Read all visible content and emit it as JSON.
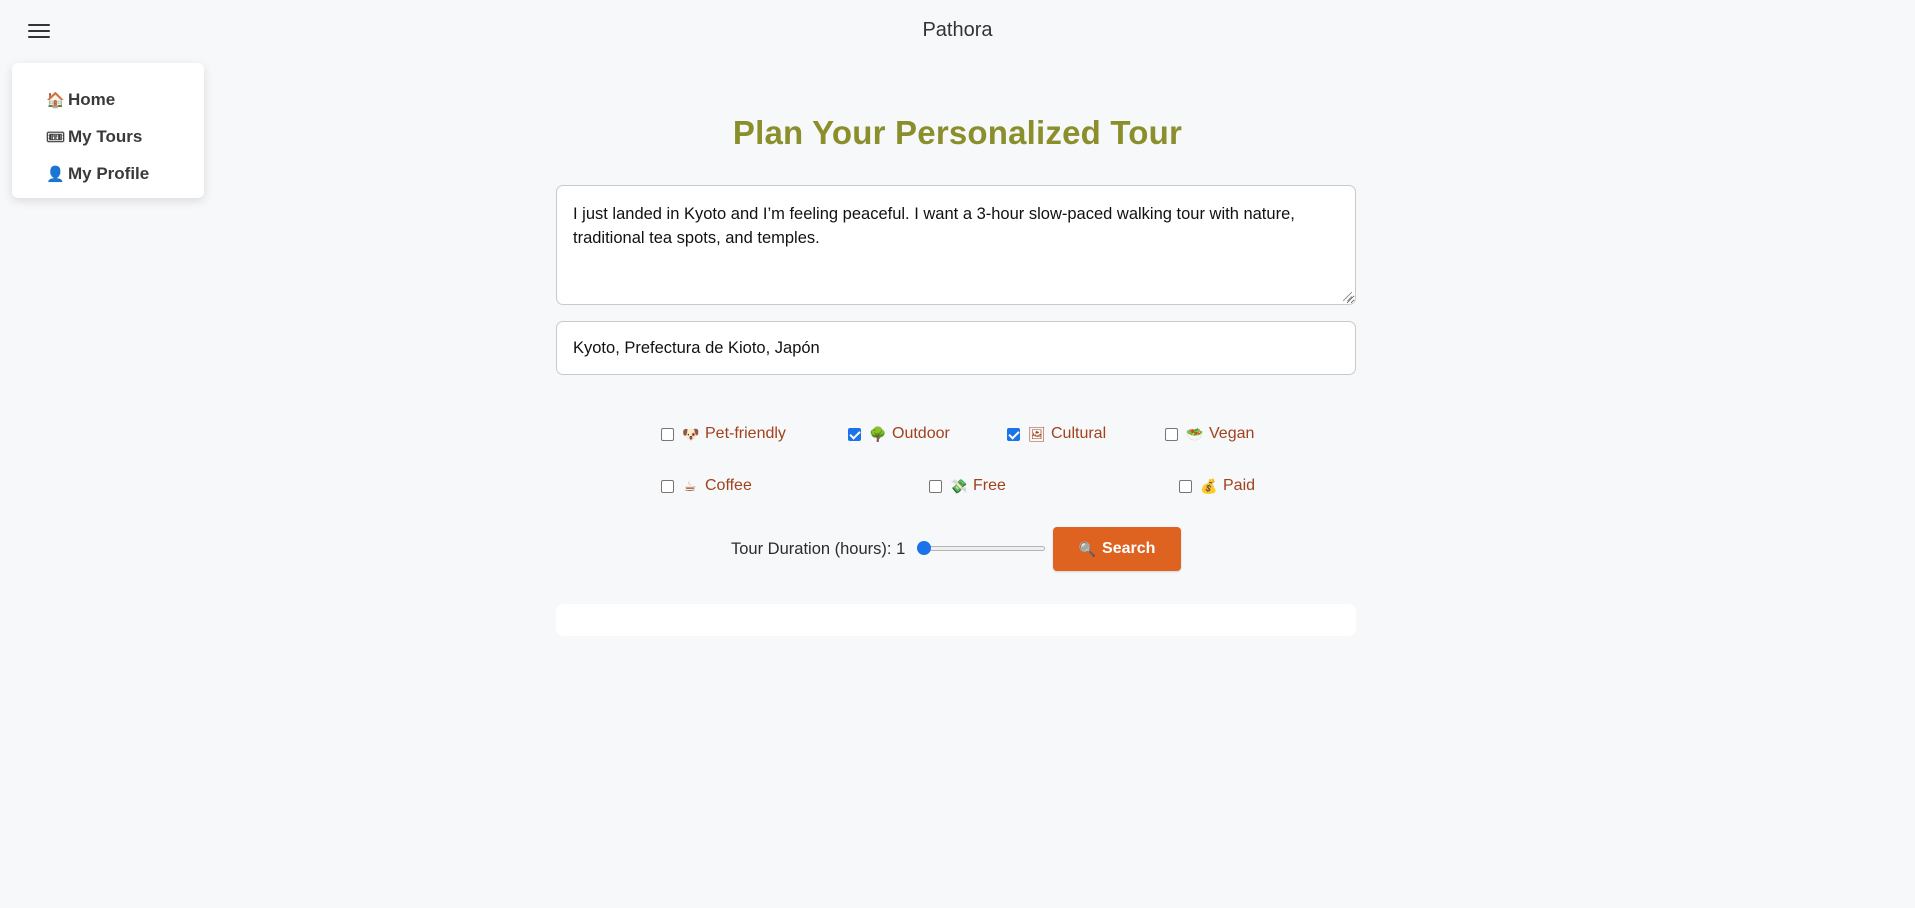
{
  "app": {
    "title": "Pathora"
  },
  "menu": {
    "items": [
      {
        "icon": "house-icon",
        "glyph": "🏠",
        "label": "Home"
      },
      {
        "icon": "ticket-icon",
        "glyph": "🎟",
        "label": "My Tours"
      },
      {
        "icon": "user-icon",
        "glyph": "👤",
        "label": "My Profile"
      }
    ]
  },
  "main": {
    "title": "Plan Your Personalized Tour",
    "prompt_value": "I just landed in Kyoto and I’m feeling peaceful. I want a 3-hour slow-paced walking tour with nature, traditional tea spots, and temples.",
    "location_value": "Kyoto, Prefectura de Kioto, Japón"
  },
  "filters": [
    {
      "label": "Pet-friendly",
      "icon": "dog-icon",
      "glyph": "🐶",
      "checked": false
    },
    {
      "label": "Outdoor",
      "icon": "tree-icon",
      "glyph": "🌳",
      "checked": true
    },
    {
      "label": "Cultural",
      "icon": "picture-icon",
      "glyph": "🖼",
      "checked": true
    },
    {
      "label": "Vegan",
      "icon": "salad-icon",
      "glyph": "🥗",
      "checked": false
    },
    {
      "label": "Coffee",
      "icon": "coffee-icon",
      "glyph": "☕",
      "checked": false
    },
    {
      "label": "Free",
      "icon": "money-icon",
      "glyph": "💸",
      "checked": false
    },
    {
      "label": "Paid",
      "icon": "money-bag-icon",
      "glyph": "💰",
      "checked": false
    }
  ],
  "duration": {
    "label": "Tour Duration (hours): 1",
    "value": 1,
    "min": 1,
    "max": 8
  },
  "search": {
    "label": "Search",
    "icon": "magnifier-icon",
    "glyph": "🔍"
  },
  "colors": {
    "title": "#8a8f2c",
    "filter_text": "#a0421b",
    "button": "#df6320",
    "checkbox": "#1a73e8"
  }
}
